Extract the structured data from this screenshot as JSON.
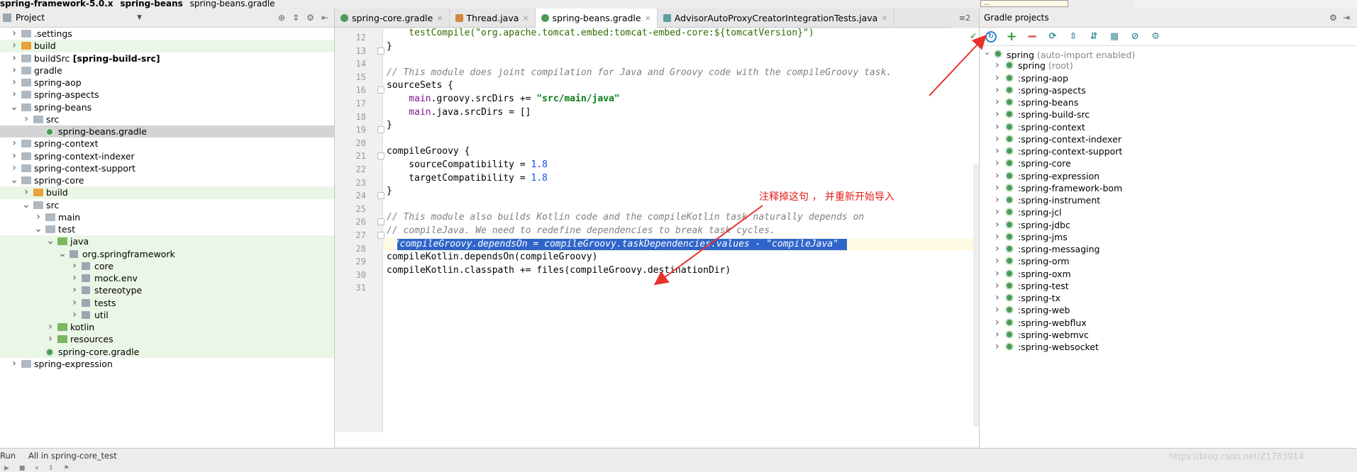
{
  "breadcrumb": [
    "spring-framework-5.0.x",
    "spring-beans",
    "spring-beans.gradle"
  ],
  "project_pane": {
    "title": "Project",
    "tree": [
      {
        "label": ".settings",
        "type": "folder",
        "depth": 0,
        "state": "collapsed",
        "style": ""
      },
      {
        "label": "build",
        "type": "orange",
        "depth": 0,
        "state": "collapsed",
        "style": "green"
      },
      {
        "label": "buildSrc",
        "bold": "[spring-build-src]",
        "type": "folder",
        "depth": 0,
        "state": "collapsed",
        "style": ""
      },
      {
        "label": "gradle",
        "type": "folder",
        "depth": 0,
        "state": "collapsed",
        "style": ""
      },
      {
        "label": "spring-aop",
        "type": "folder",
        "depth": 0,
        "state": "collapsed",
        "style": ""
      },
      {
        "label": "spring-aspects",
        "type": "folder",
        "depth": 0,
        "state": "collapsed",
        "style": ""
      },
      {
        "label": "spring-beans",
        "type": "folder",
        "depth": 0,
        "state": "expanded",
        "style": ""
      },
      {
        "label": "src",
        "type": "folder",
        "depth": 1,
        "state": "collapsed",
        "style": ""
      },
      {
        "label": "spring-beans.gradle",
        "type": "gradle",
        "depth": 2,
        "state": "none",
        "style": "sel"
      },
      {
        "label": "spring-context",
        "type": "folder",
        "depth": 0,
        "state": "collapsed",
        "style": ""
      },
      {
        "label": "spring-context-indexer",
        "type": "folder",
        "depth": 0,
        "state": "collapsed",
        "style": ""
      },
      {
        "label": "spring-context-support",
        "type": "folder",
        "depth": 0,
        "state": "collapsed",
        "style": ""
      },
      {
        "label": "spring-core",
        "type": "folder",
        "depth": 0,
        "state": "expanded",
        "style": ""
      },
      {
        "label": "build",
        "type": "orange",
        "depth": 1,
        "state": "collapsed",
        "style": "green"
      },
      {
        "label": "src",
        "type": "folder",
        "depth": 1,
        "state": "expanded",
        "style": ""
      },
      {
        "label": "main",
        "type": "folder",
        "depth": 2,
        "state": "collapsed",
        "style": ""
      },
      {
        "label": "test",
        "type": "folder",
        "depth": 2,
        "state": "expanded",
        "style": ""
      },
      {
        "label": "java",
        "type": "green-f",
        "depth": 3,
        "state": "expanded",
        "style": "green"
      },
      {
        "label": "org.springframework",
        "type": "pkg",
        "depth": 4,
        "state": "expanded",
        "style": "green"
      },
      {
        "label": "core",
        "type": "pkg",
        "depth": 5,
        "state": "collapsed",
        "style": "green"
      },
      {
        "label": "mock.env",
        "type": "pkg",
        "depth": 5,
        "state": "collapsed",
        "style": "green"
      },
      {
        "label": "stereotype",
        "type": "pkg",
        "depth": 5,
        "state": "collapsed",
        "style": "green"
      },
      {
        "label": "tests",
        "type": "pkg",
        "depth": 5,
        "state": "collapsed",
        "style": "green"
      },
      {
        "label": "util",
        "type": "pkg",
        "depth": 5,
        "state": "collapsed",
        "style": "green"
      },
      {
        "label": "kotlin",
        "type": "green-f",
        "depth": 3,
        "state": "collapsed",
        "style": "green"
      },
      {
        "label": "resources",
        "type": "green-f",
        "depth": 3,
        "state": "collapsed",
        "style": "green"
      },
      {
        "label": "spring-core.gradle",
        "type": "gradle",
        "depth": 2,
        "state": "none",
        "style": "green"
      },
      {
        "label": "spring-expression",
        "type": "folder",
        "depth": 0,
        "state": "collapsed",
        "style": ""
      }
    ]
  },
  "editor": {
    "tabs": [
      {
        "label": "spring-core.gradle",
        "icon": "gradle",
        "active": false
      },
      {
        "label": "Thread.java",
        "icon": "java",
        "active": false
      },
      {
        "label": "spring-beans.gradle",
        "icon": "gradle",
        "active": true
      },
      {
        "label": "AdvisorAutoProxyCreatorIntegrationTests.java",
        "icon": "test",
        "active": false
      }
    ],
    "tab_overflow": "≡2",
    "lines": [
      {
        "n": "12",
        "text": "    testCompile(\"org.apache.tomcat.embed:tomcat-embed-core:${tomcatVersion}\")"
      },
      {
        "n": "13",
        "text": "}"
      },
      {
        "n": "14",
        "text": ""
      },
      {
        "n": "15",
        "text": "// This module does joint compilation for Java and Groovy code with the compileGroovy task."
      },
      {
        "n": "16",
        "text": "sourceSets {"
      },
      {
        "n": "17",
        "a": "    main",
        "b": ".groovy.srcDirs += ",
        "c": "\"src/main/java\""
      },
      {
        "n": "18",
        "a": "    main",
        "b": ".java.srcDirs = []",
        "c": ""
      },
      {
        "n": "19",
        "text": "}"
      },
      {
        "n": "20",
        "text": ""
      },
      {
        "n": "21",
        "text": "compileGroovy {"
      },
      {
        "n": "22",
        "a": "    sourceCompatibility = ",
        "b": "1.8"
      },
      {
        "n": "23",
        "a": "    targetCompatibility = ",
        "b": "1.8"
      },
      {
        "n": "24",
        "text": "}"
      },
      {
        "n": "25",
        "text": ""
      },
      {
        "n": "26",
        "text": "// This module also builds Kotlin code and the compileKotlin task naturally depends on"
      },
      {
        "n": "27",
        "text": "// compileJava. We need to redefine dependencies to break task cycles."
      },
      {
        "n": "28",
        "text": "//compileGroovy.dependsOn = compileGroovy.taskDependencies.values - \"compileJava\""
      },
      {
        "n": "29",
        "text": "compileKotlin.dependsOn(compileGroovy)"
      },
      {
        "n": "30",
        "text": "compileKotlin.classpath += files(compileGroovy.destinationDir)"
      },
      {
        "n": "31",
        "text": ""
      }
    ],
    "annotation": "注释掉这句 ， 并重新开始导入"
  },
  "gradle_pane": {
    "title": "Gradle projects",
    "tooltip": "...",
    "root": {
      "label": "spring",
      "note": "(auto-import enabled)"
    },
    "items": [
      {
        "label": "spring",
        "note": "(root)"
      },
      {
        "label": ":spring-aop"
      },
      {
        "label": ":spring-aspects"
      },
      {
        "label": ":spring-beans"
      },
      {
        "label": ":spring-build-src"
      },
      {
        "label": ":spring-context"
      },
      {
        "label": ":spring-context-indexer"
      },
      {
        "label": ":spring-context-support"
      },
      {
        "label": ":spring-core"
      },
      {
        "label": ":spring-expression"
      },
      {
        "label": ":spring-framework-bom"
      },
      {
        "label": ":spring-instrument"
      },
      {
        "label": ":spring-jcl"
      },
      {
        "label": ":spring-jdbc"
      },
      {
        "label": ":spring-jms"
      },
      {
        "label": ":spring-messaging"
      },
      {
        "label": ":spring-orm"
      },
      {
        "label": ":spring-oxm"
      },
      {
        "label": ":spring-test"
      },
      {
        "label": ":spring-tx"
      },
      {
        "label": ":spring-web"
      },
      {
        "label": ":spring-webflux"
      },
      {
        "label": ":spring-webmvc"
      },
      {
        "label": ":spring-websocket"
      }
    ]
  },
  "bottom": {
    "run_label": "Run",
    "run_tab": "All in spring-core_test",
    "watermark": "https://blog.csdn.net/Z1783914"
  },
  "colors": {
    "annotation": "#e0201b",
    "selection": "#2f65ca",
    "green_bg": "#eaf6e6"
  }
}
